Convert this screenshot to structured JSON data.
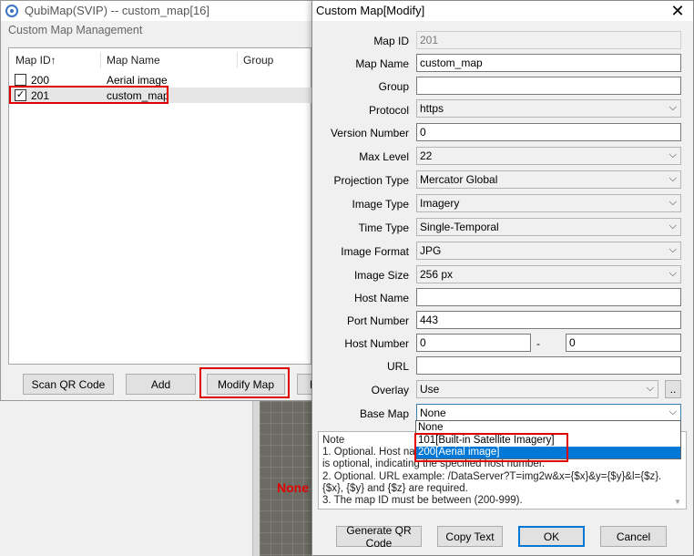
{
  "background": {
    "none_label": "None"
  },
  "main_window": {
    "title": "QubiMap(SVIP) -- custom_map[16]",
    "section_label": "Custom Map Management",
    "columns": [
      "Map ID↑",
      "Map Name",
      "Group"
    ],
    "rows": [
      {
        "id": "200",
        "name": "Aerial image",
        "checked": false
      },
      {
        "id": "201",
        "name": "custom_map",
        "checked": true
      }
    ],
    "buttons": {
      "scan_qr": "Scan QR Code",
      "add": "Add",
      "modify": "Modify Map",
      "partial": "M"
    }
  },
  "dialog": {
    "title": "Custom Map[Modify]",
    "close_glyph": "✕",
    "fields": {
      "map_id": {
        "label": "Map ID",
        "value": "201"
      },
      "map_name": {
        "label": "Map Name",
        "value": "custom_map"
      },
      "group": {
        "label": "Group",
        "value": ""
      },
      "protocol": {
        "label": "Protocol",
        "value": "https"
      },
      "version_number": {
        "label": "Version Number",
        "value": "0"
      },
      "max_level": {
        "label": "Max Level",
        "value": "22"
      },
      "projection_type": {
        "label": "Projection Type",
        "value": "Mercator Global"
      },
      "image_type": {
        "label": "Image Type",
        "value": "Imagery"
      },
      "time_type": {
        "label": "Time Type",
        "value": "Single-Temporal"
      },
      "image_format": {
        "label": "Image Format",
        "value": "JPG"
      },
      "image_size": {
        "label": "Image Size",
        "value": "256 px"
      },
      "host_name": {
        "label": "Host Name",
        "value": ""
      },
      "port_number": {
        "label": "Port Number",
        "value": "443"
      },
      "host_number": {
        "label": "Host Number",
        "from": "0",
        "separator": "-",
        "to": "0"
      },
      "url": {
        "label": "URL",
        "value": ""
      },
      "overlay": {
        "label": "Overlay",
        "value": "Use",
        "more_button": ".."
      },
      "base_map": {
        "label": "Base Map",
        "value": "None"
      }
    },
    "base_map_options": [
      "None",
      "101[Built-in Satellite Imagery]",
      "200[Aerial image]"
    ],
    "base_map_highlighted": "200[Aerial image]",
    "note_lines": [
      "Note",
      "1. Optional. Host nam",
      "is optional, indicating the specified host number.",
      "2. Optional. URL example: /DataServer?T=img2w&x={$x}&y={$y}&l={$z}.",
      "{$x}, {$y} and {$z} are required.",
      "3. The map ID must be between (200-999)."
    ],
    "buttons": {
      "generate_qr": "Generate QR Code",
      "copy_text": "Copy Text",
      "ok": "OK",
      "cancel": "Cancel"
    }
  },
  "colors": {
    "highlight_red": "#e00000",
    "selection_blue": "#0078d7"
  }
}
